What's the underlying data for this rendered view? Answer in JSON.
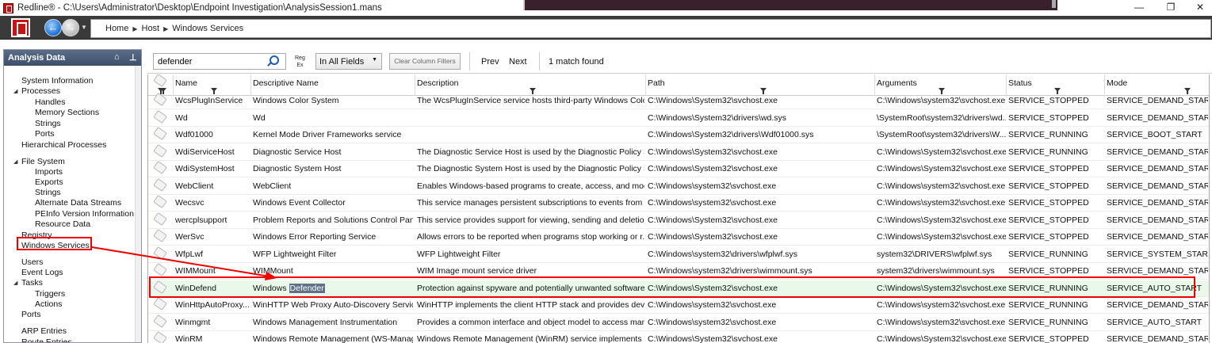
{
  "window": {
    "title": "Redline® - C:\\Users\\Administrator\\Desktop\\Endpoint Investigation\\AnalysisSession1.mans"
  },
  "breadcrumb": [
    "Home",
    "Host",
    "Windows Services"
  ],
  "sidebar": {
    "title": "Analysis Data",
    "items": [
      {
        "label": "System Information",
        "level": 0
      },
      {
        "label": "Processes",
        "level": 0,
        "expanded": true
      },
      {
        "label": "Handles",
        "level": 1
      },
      {
        "label": "Memory Sections",
        "level": 1
      },
      {
        "label": "Strings",
        "level": 1
      },
      {
        "label": "Ports",
        "level": 1
      },
      {
        "label": "Hierarchical Processes",
        "level": 0
      },
      {
        "label": "File System",
        "level": 0,
        "expanded": true
      },
      {
        "label": "Imports",
        "level": 1
      },
      {
        "label": "Exports",
        "level": 1
      },
      {
        "label": "Strings",
        "level": 1
      },
      {
        "label": "Alternate Data Streams",
        "level": 1
      },
      {
        "label": "PEInfo Version Information",
        "level": 1
      },
      {
        "label": "Resource Data",
        "level": 1
      },
      {
        "label": "Registry",
        "level": 0
      },
      {
        "label": "Windows Services",
        "level": 0,
        "selected": true
      },
      {
        "label": "Users",
        "level": 0
      },
      {
        "label": "Event Logs",
        "level": 0
      },
      {
        "label": "Tasks",
        "level": 0,
        "expanded": true
      },
      {
        "label": "Triggers",
        "level": 1
      },
      {
        "label": "Actions",
        "level": 1
      },
      {
        "label": "Ports",
        "level": 0
      },
      {
        "label": "ARP Entries",
        "level": 0
      },
      {
        "label": "Route Entries",
        "level": 0
      }
    ]
  },
  "toolbar": {
    "search_value": "defender",
    "regex_label_1": "Reg",
    "regex_label_2": "Ex",
    "scope_value": "In All Fields",
    "clear_label": "Clear Column Filters",
    "prev_label": "Prev",
    "next_label": "Next",
    "match_text": "1 match found"
  },
  "table": {
    "columns": [
      "Name",
      "Descriptive Name",
      "Description",
      "Path",
      "Arguments",
      "Status",
      "Mode"
    ],
    "rows": [
      [
        "WcsPlugInService",
        "Windows Color System",
        "The WcsPlugInService service hosts third-party Windows Color...",
        "C:\\Windows\\System32\\svchost.exe",
        "C:\\Windows\\system32\\svchost.exe...",
        "SERVICE_STOPPED",
        "SERVICE_DEMAND_START"
      ],
      [
        "Wd",
        "Wd",
        "",
        "C:\\Windows\\System32\\drivers\\wd.sys",
        "\\SystemRoot\\system32\\drivers\\wd...",
        "SERVICE_STOPPED",
        "SERVICE_DEMAND_START"
      ],
      [
        "Wdf01000",
        "Kernel Mode Driver Frameworks service",
        "",
        "C:\\Windows\\System32\\drivers\\Wdf01000.sys",
        "\\SystemRoot\\system32\\drivers\\W...",
        "SERVICE_RUNNING",
        "SERVICE_BOOT_START"
      ],
      [
        "WdiServiceHost",
        "Diagnostic Service Host",
        "The Diagnostic Service Host is used by the Diagnostic Policy Se...",
        "C:\\Windows\\System32\\svchost.exe",
        "C:\\Windows\\System32\\svchost.exe...",
        "SERVICE_RUNNING",
        "SERVICE_DEMAND_START"
      ],
      [
        "WdiSystemHost",
        "Diagnostic System Host",
        "The Diagnostic System Host is used by the Diagnostic Policy Se...",
        "C:\\Windows\\System32\\svchost.exe",
        "C:\\Windows\\System32\\svchost.exe...",
        "SERVICE_STOPPED",
        "SERVICE_DEMAND_START"
      ],
      [
        "WebClient",
        "WebClient",
        "Enables Windows-based programs to create, access, and modif...",
        "C:\\Windows\\system32\\svchost.exe",
        "C:\\Windows\\system32\\svchost.exe...",
        "SERVICE_STOPPED",
        "SERVICE_DEMAND_START"
      ],
      [
        "Wecsvc",
        "Windows Event Collector",
        "This service manages persistent subscriptions to events from r...",
        "C:\\Windows\\system32\\svchost.exe",
        "C:\\Windows\\system32\\svchost.exe...",
        "SERVICE_STOPPED",
        "SERVICE_DEMAND_START"
      ],
      [
        "wercplsupport",
        "Problem Reports and Solutions Control Pan...",
        "This service provides support for viewing, sending and deletion...",
        "C:\\Windows\\System32\\svchost.exe",
        "C:\\Windows\\System32\\svchost.exe...",
        "SERVICE_STOPPED",
        "SERVICE_DEMAND_START"
      ],
      [
        "WerSvc",
        "Windows Error Reporting Service",
        "Allows errors to be reported when programs stop working or r...",
        "C:\\Windows\\System32\\svchost.exe",
        "C:\\Windows\\System32\\svchost.exe...",
        "SERVICE_STOPPED",
        "SERVICE_DEMAND_START"
      ],
      [
        "WfpLwf",
        "WFP Lightweight Filter",
        "WFP Lightweight Filter",
        "C:\\Windows\\system32\\drivers\\wfplwf.sys",
        "system32\\DRIVERS\\wfplwf.sys",
        "SERVICE_RUNNING",
        "SERVICE_SYSTEM_START"
      ],
      [
        "WIMMount",
        "WIMMount",
        "WIM Image mount service driver",
        "C:\\Windows\\system32\\drivers\\wimmount.sys",
        "system32\\drivers\\wimmount.sys",
        "SERVICE_STOPPED",
        "SERVICE_DEMAND_START"
      ],
      [
        "WinDefend",
        "Windows Defender",
        "Protection against spyware and potentially unwanted software",
        "C:\\Windows\\System32\\svchost.exe",
        "C:\\Windows\\System32\\svchost.exe...",
        "SERVICE_RUNNING",
        "SERVICE_AUTO_START"
      ],
      [
        "WinHttpAutoProxy...",
        "WinHTTP Web Proxy Auto-Discovery Service",
        "WinHTTP implements the client HTTP stack and provides devel...",
        "C:\\Windows\\system32\\svchost.exe",
        "C:\\Windows\\system32\\svchost.exe...",
        "SERVICE_RUNNING",
        "SERVICE_DEMAND_START"
      ],
      [
        "Winmgmt",
        "Windows Management Instrumentation",
        "Provides a common interface and object model to access man...",
        "C:\\Windows\\system32\\svchost.exe",
        "C:\\Windows\\system32\\svchost.exe...",
        "SERVICE_RUNNING",
        "SERVICE_AUTO_START"
      ],
      [
        "WinRM",
        "Windows Remote Management (WS-Manag...",
        "Windows Remote Management (WinRM) service implements t...",
        "C:\\Windows\\System32\\svchost.exe",
        "C:\\Windows\\System32\\svchost.exe...",
        "SERVICE_STOPPED",
        "SERVICE_DEMAND_START"
      ]
    ],
    "highlight_row": 11,
    "highlight_word": "Defender"
  },
  "colors": {
    "annotation_red": "#e00000",
    "highlight_row_bg": "#e9f8e9",
    "sidebar_header": "#3d4f6b"
  },
  "icons": [
    "redline-logo-icon",
    "back-arrow-icon",
    "forward-arrow-icon",
    "home-icon",
    "pin-icon",
    "search-icon",
    "filter-icon",
    "tag-icon"
  ]
}
